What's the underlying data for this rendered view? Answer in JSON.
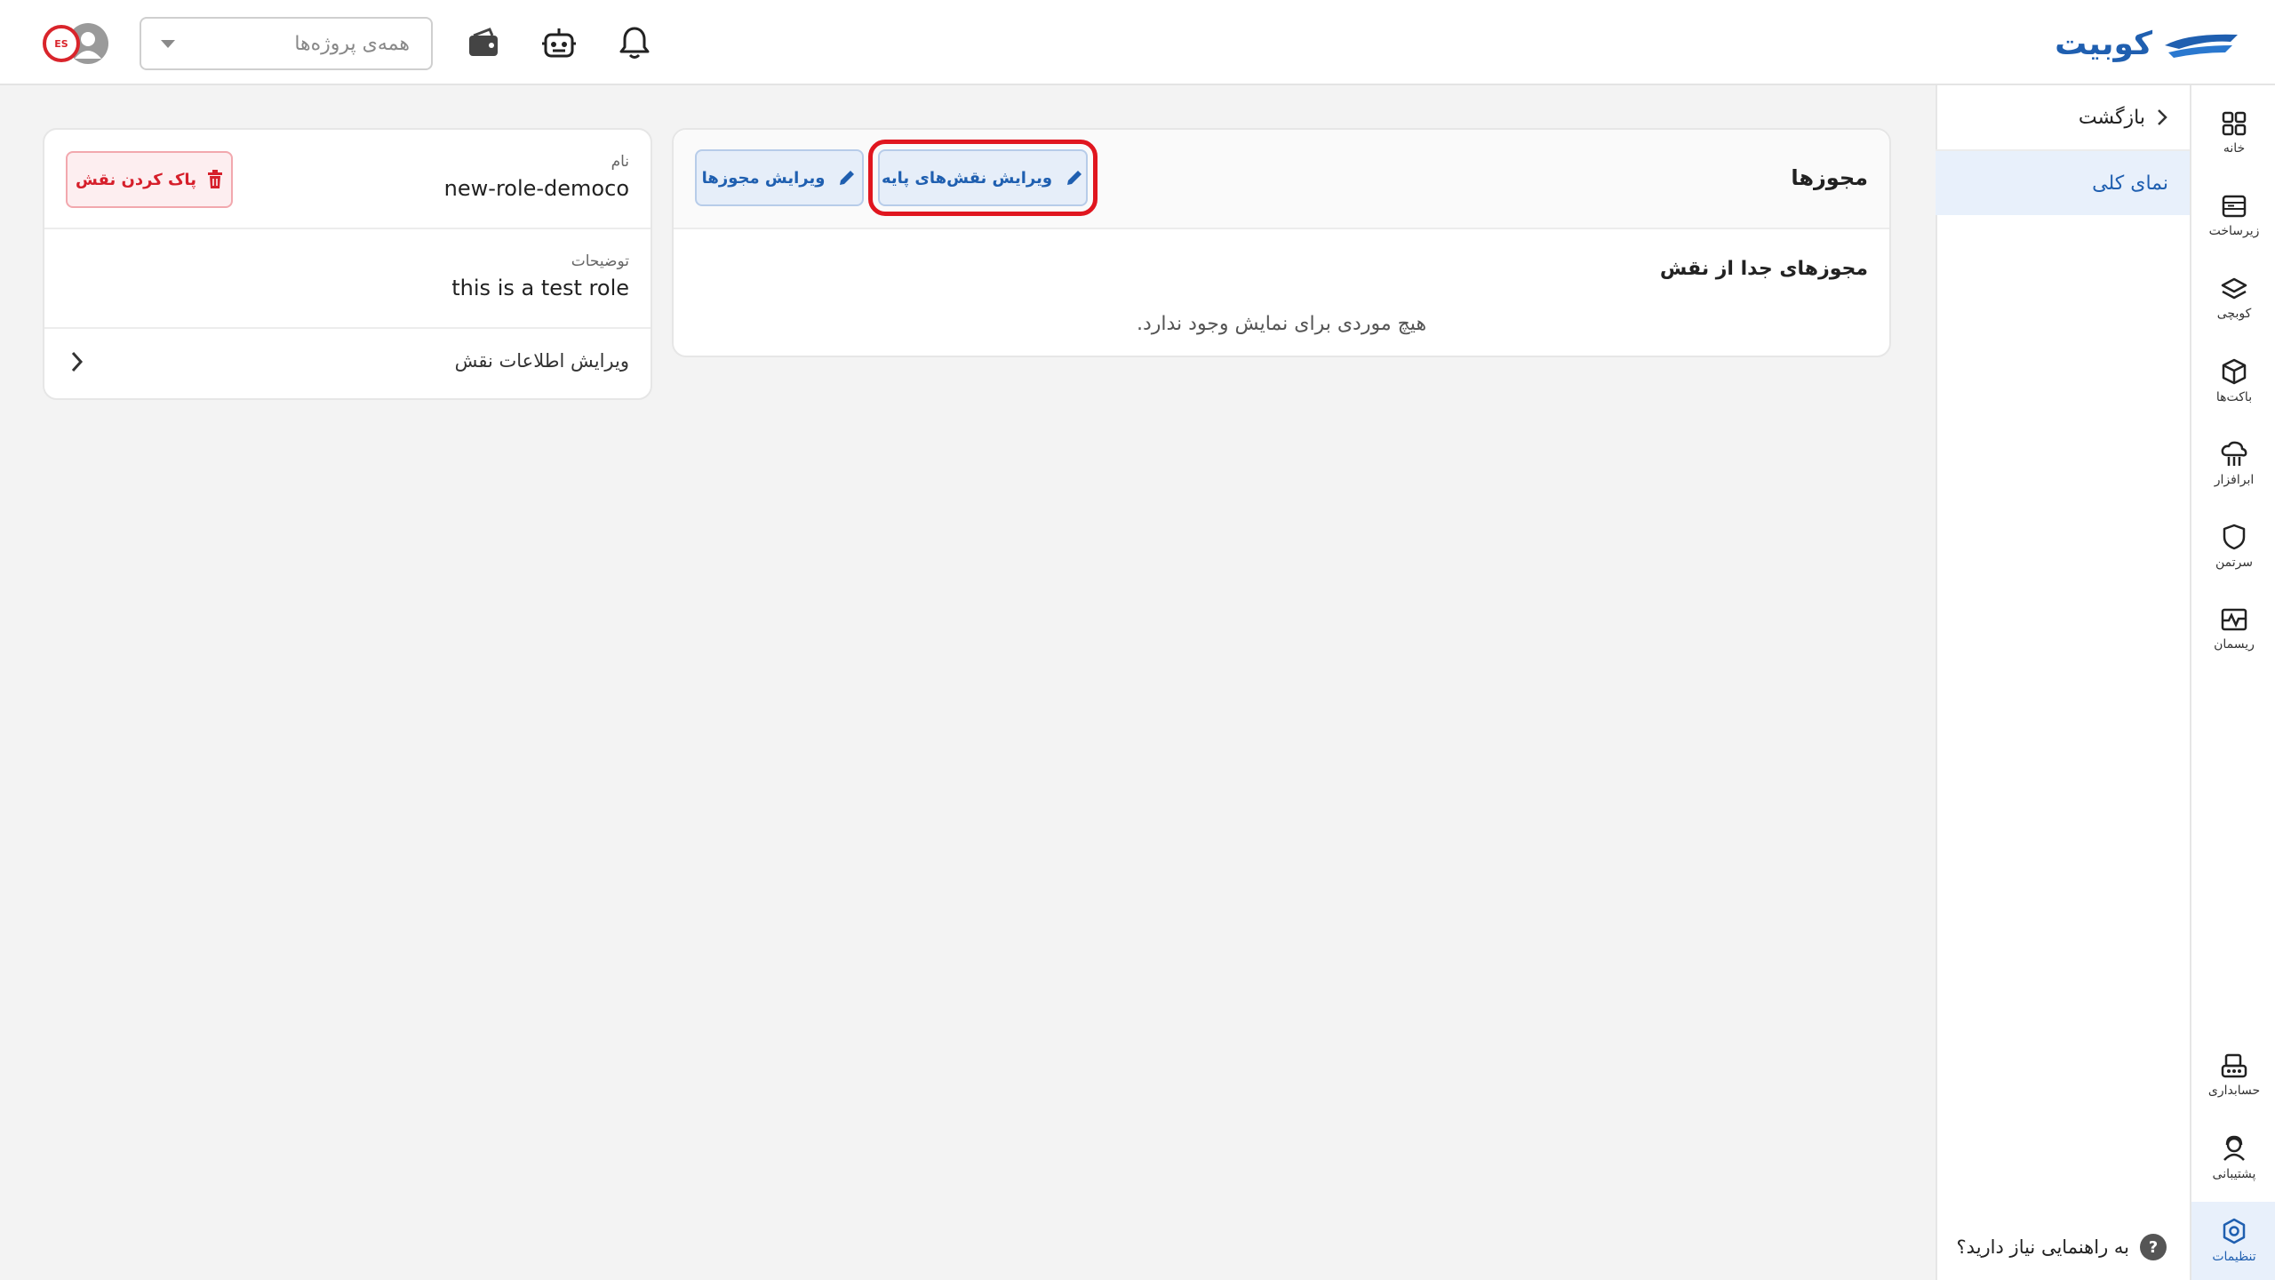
{
  "brand": {
    "name": "کوبیت",
    "color": "#1f5fb0"
  },
  "header": {
    "project_select": {
      "value": "همه‌ی پروژه‌ها"
    },
    "icons": [
      "bell-icon",
      "robot-icon",
      "wallet-icon"
    ],
    "avatar_badge": "ES"
  },
  "rail": {
    "items": [
      {
        "label": "خانه",
        "icon": "grid-icon"
      },
      {
        "label": "زیرساخت",
        "icon": "server-icon"
      },
      {
        "label": "کوبچی",
        "icon": "layers-icon"
      },
      {
        "label": "باکت‌ها",
        "icon": "cube-icon"
      },
      {
        "label": "ابرافزار",
        "icon": "cloud-icon"
      },
      {
        "label": "سرتمن",
        "icon": "shield-icon"
      },
      {
        "label": "ریسمان",
        "icon": "pulse-icon"
      }
    ],
    "bottom_items": [
      {
        "label": "حسابداری",
        "icon": "accounting-icon"
      },
      {
        "label": "پشتیبانی",
        "icon": "support-icon"
      },
      {
        "label": "تنظیمات",
        "icon": "settings-icon",
        "active": true
      }
    ]
  },
  "subnav": {
    "back_label": "بازگشت",
    "active_item": "نمای کلی",
    "help_text": "به راهنمایی نیاز دارید؟",
    "help_icon": "?"
  },
  "permissions_card": {
    "title": "مجوزها",
    "edit_base_roles_label": "ویرایش نقش‌های پایه",
    "edit_permissions_label": "ویرایش مجوزها",
    "section_title": "مجوزهای جدا از نقش",
    "empty_text": "هیچ موردی برای نمایش وجود ندارد."
  },
  "role_card": {
    "name_label": "نام",
    "name_value": "new-role-democo",
    "description_label": "توضیحات",
    "description_value": "this is a test role",
    "delete_label": "پاک کردن نقش",
    "edit_info_label": "ویرایش اطلاعات نقش"
  },
  "colors": {
    "accent": "#1f5fb0",
    "danger": "#d61f2b",
    "highlight": "#e0161f"
  }
}
